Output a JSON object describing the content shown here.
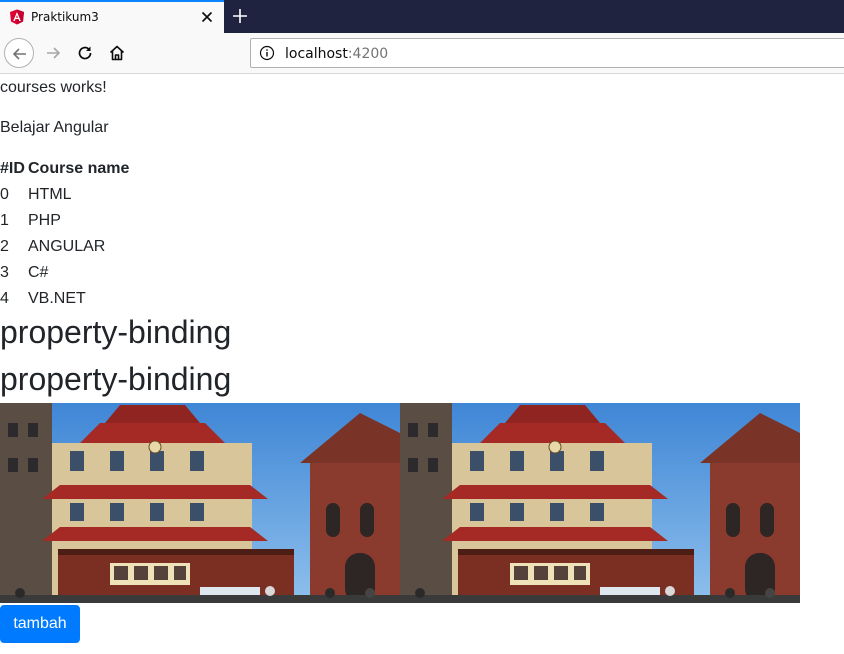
{
  "browser": {
    "tab_title": "Praktikum3",
    "url_host": "localhost",
    "url_port": ":4200"
  },
  "page": {
    "courses_works": "courses works!",
    "subtitle": "Belajar Angular",
    "table": {
      "headers": [
        "#ID",
        "Course name"
      ],
      "rows": [
        [
          "0",
          "HTML"
        ],
        [
          "1",
          "PHP"
        ],
        [
          "2",
          "ANGULAR"
        ],
        [
          "3",
          "C#"
        ],
        [
          "4",
          "VB.NET"
        ]
      ]
    },
    "heading_1": "property-binding",
    "heading_2": "property-binding",
    "button_label": "tambah"
  },
  "colors": {
    "primary": "#007bff",
    "tab_accent": "#0a84ff",
    "chrome_dark": "#202340"
  },
  "icons": [
    "angular-favicon-icon",
    "close-icon",
    "plus-icon",
    "back-arrow-icon",
    "forward-arrow-icon",
    "reload-icon",
    "home-icon",
    "info-icon"
  ]
}
